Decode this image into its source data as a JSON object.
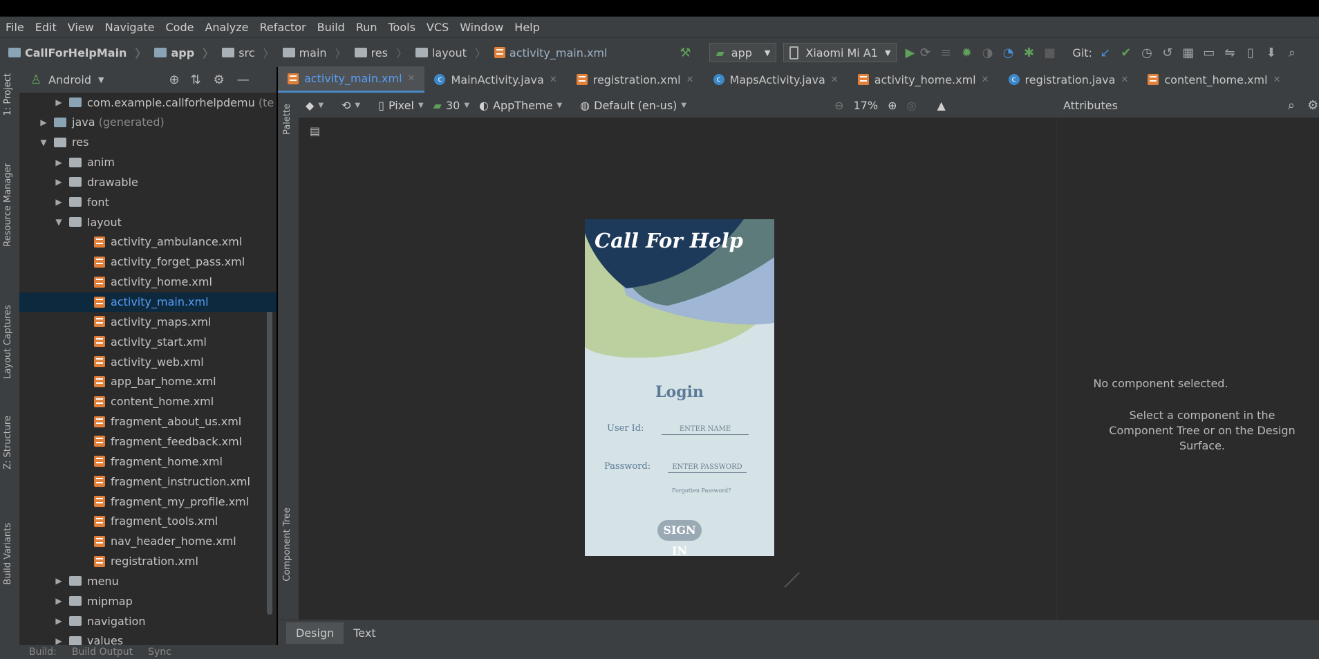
{
  "menu": [
    "File",
    "Edit",
    "View",
    "Navigate",
    "Code",
    "Analyze",
    "Refactor",
    "Build",
    "Run",
    "Tools",
    "VCS",
    "Window",
    "Help"
  ],
  "breadcrumbs": [
    "CallForHelpMain",
    "app",
    "src",
    "main",
    "res",
    "layout",
    "activity_main.xml"
  ],
  "toolbar": {
    "run_config": "app",
    "device": "Xiaomi Mi A1",
    "git_label": "Git:"
  },
  "side_tools": [
    "1: Project",
    "Resource Manager",
    "Layout Captures",
    "Z: Structure",
    "Build Variants"
  ],
  "project": {
    "view_selector": "Android",
    "tree": [
      {
        "label": "com.example.callforhelpdemu",
        "suffix": " (te",
        "level": 2,
        "arrow": "right",
        "kind": "package"
      },
      {
        "label": "java",
        "suffix": " (generated)",
        "level": 1,
        "arrow": "right",
        "kind": "package"
      },
      {
        "label": "res",
        "level": 1,
        "arrow": "down",
        "kind": "res"
      },
      {
        "label": "anim",
        "level": 2,
        "arrow": "right",
        "kind": "folder"
      },
      {
        "label": "drawable",
        "level": 2,
        "arrow": "right",
        "kind": "folder"
      },
      {
        "label": "font",
        "level": 2,
        "arrow": "right",
        "kind": "folder"
      },
      {
        "label": "layout",
        "level": 2,
        "arrow": "down",
        "kind": "folder"
      },
      {
        "label": "activity_ambulance.xml",
        "level": 3,
        "kind": "xml"
      },
      {
        "label": "activity_forget_pass.xml",
        "level": 3,
        "kind": "xml"
      },
      {
        "label": "activity_home.xml",
        "level": 3,
        "kind": "xml"
      },
      {
        "label": "activity_main.xml",
        "level": 3,
        "kind": "xml",
        "selected": true
      },
      {
        "label": "activity_maps.xml",
        "level": 3,
        "kind": "xml"
      },
      {
        "label": "activity_start.xml",
        "level": 3,
        "kind": "xml"
      },
      {
        "label": "activity_web.xml",
        "level": 3,
        "kind": "xml"
      },
      {
        "label": "app_bar_home.xml",
        "level": 3,
        "kind": "xml"
      },
      {
        "label": "content_home.xml",
        "level": 3,
        "kind": "xml"
      },
      {
        "label": "fragment_about_us.xml",
        "level": 3,
        "kind": "xml"
      },
      {
        "label": "fragment_feedback.xml",
        "level": 3,
        "kind": "xml"
      },
      {
        "label": "fragment_home.xml",
        "level": 3,
        "kind": "xml"
      },
      {
        "label": "fragment_instruction.xml",
        "level": 3,
        "kind": "xml"
      },
      {
        "label": "fragment_my_profile.xml",
        "level": 3,
        "kind": "xml"
      },
      {
        "label": "fragment_tools.xml",
        "level": 3,
        "kind": "xml"
      },
      {
        "label": "nav_header_home.xml",
        "level": 3,
        "kind": "xml"
      },
      {
        "label": "registration.xml",
        "level": 3,
        "kind": "xml"
      },
      {
        "label": "menu",
        "level": 2,
        "arrow": "right",
        "kind": "folder"
      },
      {
        "label": "mipmap",
        "level": 2,
        "arrow": "right",
        "kind": "folder"
      },
      {
        "label": "navigation",
        "level": 2,
        "arrow": "right",
        "kind": "folder"
      },
      {
        "label": "values",
        "level": 2,
        "arrow": "right",
        "kind": "folder"
      }
    ]
  },
  "editor_tabs": [
    {
      "label": "activity_main.xml",
      "kind": "xml",
      "active": true
    },
    {
      "label": "MainActivity.java",
      "kind": "java"
    },
    {
      "label": "registration.xml",
      "kind": "xml"
    },
    {
      "label": "MapsActivity.java",
      "kind": "java"
    },
    {
      "label": "activity_home.xml",
      "kind": "xml"
    },
    {
      "label": "registration.java",
      "kind": "java"
    },
    {
      "label": "content_home.xml",
      "kind": "xml"
    }
  ],
  "designer": {
    "device": "Pixel",
    "api": "30",
    "theme": "AppTheme",
    "locale": "Default (en-us)",
    "zoom": "17%",
    "palette_label": "Palette",
    "component_tree_label": "Component Tree"
  },
  "phone": {
    "app_title": "Call For Help",
    "login_heading": "Login",
    "user_label": "User Id:",
    "user_placeholder": "ENTER NAME",
    "password_label": "Password:",
    "password_placeholder": "ENTER PASSWORD",
    "forgot": "Forgotten Password?",
    "sign_in": "SIGN IN"
  },
  "attributes": {
    "title": "Attributes",
    "empty_title": "No component selected.",
    "empty_hint": "Select a component in the Component Tree or on the Design Surface."
  },
  "design_tabs": [
    "Design",
    "Text"
  ],
  "bottom": [
    "Build:",
    "Build Output",
    "Sync"
  ]
}
